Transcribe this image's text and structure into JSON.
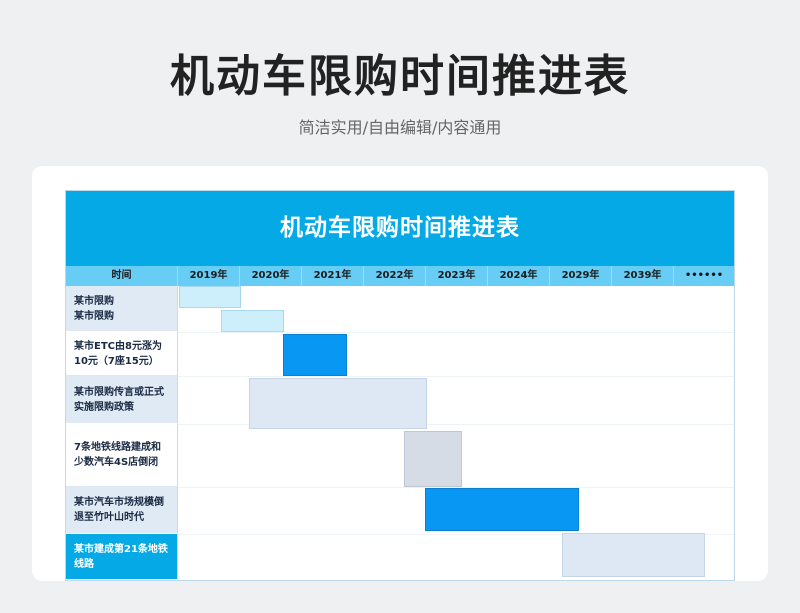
{
  "page": {
    "title": "机动车限购时间推进表",
    "subtitle": "简洁实用/自由编辑/内容通用"
  },
  "sheet": {
    "title": "机动车限购时间推进表",
    "axis": {
      "label": "时间",
      "years": [
        "2019年",
        "2020年",
        "2021年",
        "2022年",
        "2023年",
        "2024年",
        "2029年",
        "2039年",
        "••••••"
      ]
    },
    "rows": [
      {
        "label": "某市限购\n某市限购"
      },
      {
        "label": "某市ETC由8元涨为10元（7座15元）"
      },
      {
        "label": "某市限购传言或正式实施限购政策"
      },
      {
        "label": "7条地铁线路建成和少数汽车4S店倒闭"
      },
      {
        "label": "某市汽车市场规模倒退至竹叶山时代"
      },
      {
        "label": "某市建成第21条地铁线路"
      }
    ]
  },
  "colors": {
    "header": "#04a9e6",
    "axis": "#67cdf5",
    "bar_blue": "#0898f3",
    "bar_light": "#cdeffb",
    "bar_pale": "#dde8f4",
    "bar_gray": "#d6dce6"
  }
}
